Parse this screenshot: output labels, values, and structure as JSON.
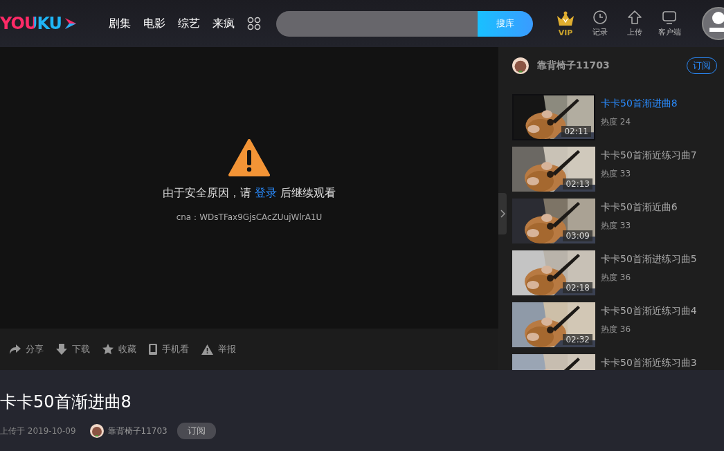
{
  "header": {
    "logo": "YOUKU",
    "nav": [
      {
        "label": "剧集"
      },
      {
        "label": "电影"
      },
      {
        "label": "综艺"
      },
      {
        "label": "来疯"
      }
    ],
    "search": {
      "button": "搜库"
    },
    "actions": [
      {
        "kind": "vip",
        "label": "VIP"
      },
      {
        "kind": "history",
        "label": "记录"
      },
      {
        "kind": "upload",
        "label": "上传"
      },
      {
        "kind": "client",
        "label": "客户端"
      }
    ]
  },
  "player": {
    "warning": {
      "before": "由于安全原因，请 ",
      "link": "登录",
      "after": " 后继续观看"
    },
    "code": "cna：WDsTFax9GjsCAcZUujWlrA1U"
  },
  "toolbar": [
    {
      "kind": "share",
      "label": "分享"
    },
    {
      "kind": "download",
      "label": "下载"
    },
    {
      "kind": "favorite",
      "label": "收藏"
    },
    {
      "kind": "phone",
      "label": "手机看"
    },
    {
      "kind": "report",
      "label": "举报"
    }
  ],
  "sidebar": {
    "channel": "靠背椅子11703",
    "subscribe": "订阅",
    "videos": [
      {
        "title": "卡卡50首渐进曲8",
        "heat": "热度 24",
        "duration": "02:11",
        "selected": true
      },
      {
        "title": "卡卡50首渐近练习曲7",
        "heat": "热度 33",
        "duration": "02:13",
        "selected": false
      },
      {
        "title": "卡卡50首渐近曲6",
        "heat": "热度 33",
        "duration": "03:09",
        "selected": false
      },
      {
        "title": "卡卡50首渐进练习曲5",
        "heat": "热度 36",
        "duration": "02:18",
        "selected": false
      },
      {
        "title": "卡卡50首渐近练习曲4",
        "heat": "热度 36",
        "duration": "02:32",
        "selected": false
      },
      {
        "title": "卡卡50首渐近练习曲3",
        "selected": false
      }
    ]
  },
  "video_info": {
    "title": "卡卡50首渐进曲8",
    "uploaded": "上传于 2019-10-09",
    "author": "靠背椅子11703",
    "subscribe": "订阅"
  }
}
